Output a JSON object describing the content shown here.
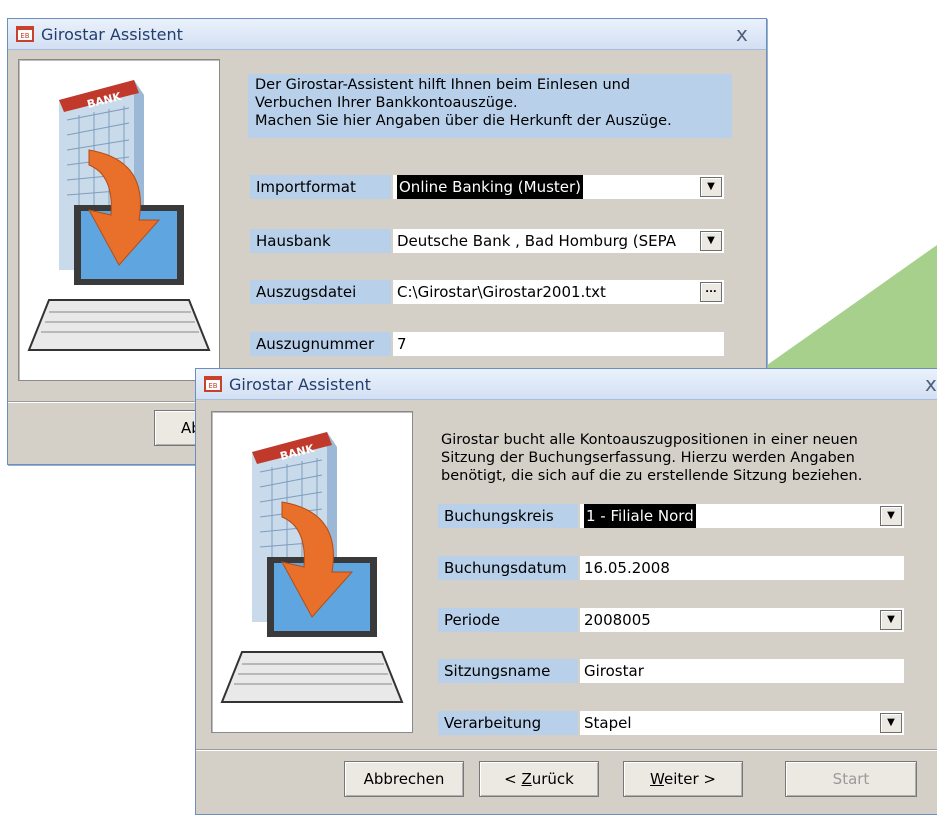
{
  "window1": {
    "title": "Girostar Assistent",
    "close": "x",
    "intro_lines": [
      "Der Girostar-Assistent hilft Ihnen beim Einlesen und",
      "Verbuchen Ihrer Bankkontoauszüge.",
      "Machen Sie hier Angaben über die Herkunft der Auszüge."
    ],
    "bank_sign": "BANK",
    "fields": [
      {
        "label": "Importformat",
        "value": "Online Banking (Muster)",
        "type": "dropdown",
        "selected": true
      },
      {
        "label": "Hausbank",
        "value": "Deutsche Bank , Bad Homburg (SEPA",
        "type": "dropdown",
        "selected": false
      },
      {
        "label": "Auszugsdatei",
        "value": "C:\\Girostar\\Girostar2001.txt",
        "type": "browse",
        "selected": false
      },
      {
        "label": "Auszugnummer",
        "value": "7",
        "type": "text",
        "selected": false
      }
    ],
    "browse_label": "...",
    "dropdown_glyph": "▼",
    "partial_button": "Ab"
  },
  "window2": {
    "title": "Girostar Assistent",
    "close": "x",
    "intro_lines": [
      "Girostar bucht alle Kontoauszugpositionen in einer neuen",
      "Sitzung der Buchungserfassung. Hierzu werden Angaben",
      "benötigt, die sich auf die zu erstellende Sitzung beziehen."
    ],
    "bank_sign": "BANK",
    "fields": [
      {
        "label": "Buchungskreis",
        "value": "1 - Filiale Nord",
        "type": "dropdown",
        "selected": true
      },
      {
        "label": "Buchungsdatum",
        "value": "16.05.2008",
        "type": "text",
        "selected": false
      },
      {
        "label": "Periode",
        "value": "2008005",
        "type": "dropdown",
        "selected": false
      },
      {
        "label": "Sitzungsname",
        "value": "Girostar",
        "type": "text",
        "selected": false
      },
      {
        "label": "Verarbeitung",
        "value": "Stapel",
        "type": "dropdown",
        "selected": false
      }
    ],
    "dropdown_glyph": "▼",
    "buttons": {
      "cancel": "Abbrechen",
      "back_prefix": "< ",
      "back_key": "Z",
      "back_rest": "urück",
      "next_key": "W",
      "next_rest": "eiter >",
      "start": "Start"
    }
  },
  "colors": {
    "dialog_bg": "#d4d0c8",
    "label_bg": "#b8d0ea",
    "title_text": "#233e6e",
    "accent_green": "#a8d08d",
    "arrow_orange": "#e8702a"
  }
}
